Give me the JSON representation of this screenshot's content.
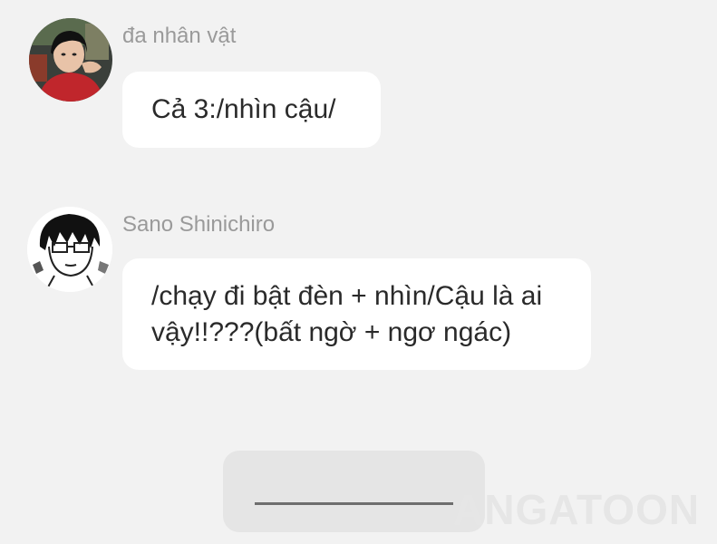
{
  "messages": [
    {
      "sender": "đa nhân vật",
      "text": "Cả 3:/nhìn cậu/",
      "avatar_icon": "user-photo-avatar-icon"
    },
    {
      "sender": "Sano Shinichiro",
      "text": "/chạy đi bật đèn + nhìn/Cậu là ai vậy!!???(bất ngờ + ngơ ngác)",
      "avatar_icon": "manga-character-avatar-icon"
    }
  ],
  "watermark": "ANGATOON",
  "colors": {
    "background": "#f2f2f2",
    "bubble": "#ffffff",
    "sender_text": "#9a9a9a",
    "message_text": "#2a2a2a",
    "composer": "#e5e5e5"
  }
}
